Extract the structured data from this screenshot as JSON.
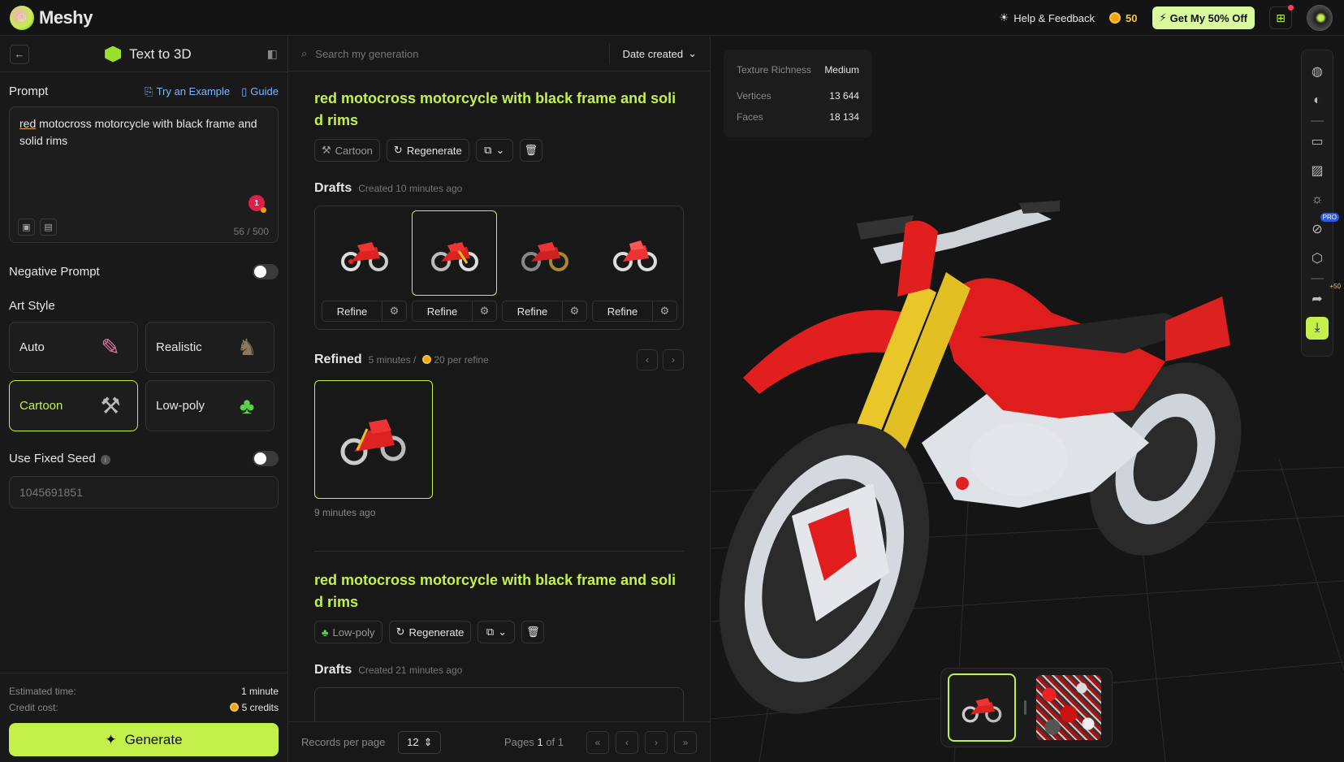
{
  "app": {
    "name": "Meshy"
  },
  "topbar": {
    "help_label": "Help & Feedback",
    "credits": "50",
    "deal_label": "Get My 50% Off"
  },
  "left": {
    "title": "Text to 3D",
    "prompt_label": "Prompt",
    "try_example": "Try an Example",
    "guide": "Guide",
    "prompt_first_word": "red",
    "prompt_rest": " motocross motorcycle with black frame and solid rims",
    "notification_count": "1",
    "char_counter": "56 / 500",
    "negative_prompt_label": "Negative Prompt",
    "negative_prompt_enabled": false,
    "art_style_label": "Art Style",
    "styles": [
      {
        "label": "Auto",
        "icon": "wand-icon",
        "selected": false
      },
      {
        "label": "Realistic",
        "icon": "creature-icon",
        "selected": false
      },
      {
        "label": "Cartoon",
        "icon": "hammer-icon",
        "selected": true
      },
      {
        "label": "Low-poly",
        "icon": "tree-icon",
        "selected": false
      }
    ],
    "fixed_seed_label": "Use Fixed Seed",
    "fixed_seed_enabled": false,
    "seed_placeholder": "1045691851",
    "estimated_time_label": "Estimated time:",
    "estimated_time": "1 minute",
    "credit_cost_label": "Credit cost:",
    "credit_cost": "5 credits",
    "generate_label": "Generate"
  },
  "middle": {
    "search_placeholder": "Search my generation",
    "sort_label": "Date created",
    "generations": [
      {
        "title": "red motocross motorcycle with black frame and solid rims",
        "style": "Cartoon",
        "regenerate": "Regenerate",
        "drafts_label": "Drafts",
        "drafts_meta": "Created 10 minutes ago",
        "drafts": [
          {
            "refine": "Refine",
            "selected": false
          },
          {
            "refine": "Refine",
            "selected": true
          },
          {
            "refine": "Refine",
            "selected": false
          },
          {
            "refine": "Refine",
            "selected": false
          }
        ],
        "refined_label": "Refined",
        "refined_meta_time": "5 minutes /",
        "refined_meta_cost": "20 per refine",
        "refined_ago": "9 minutes ago"
      },
      {
        "title": "red motocross motorcycle with black frame and solid rims",
        "style": "Low-poly",
        "regenerate": "Regenerate",
        "drafts_label": "Drafts",
        "drafts_meta": "Created 21 minutes ago"
      }
    ],
    "records_per_page_label": "Records per page",
    "records_per_page": "12",
    "pages_prefix": "Pages",
    "page_current": "1",
    "pages_suffix": "of 1"
  },
  "viewer": {
    "texture_richness_label": "Texture Richness",
    "texture_richness": "Medium",
    "vertices_label": "Vertices",
    "vertices": "13 644",
    "faces_label": "Faces",
    "faces": "18 134",
    "pro_badge": "PRO",
    "share_bonus": "+50"
  },
  "colors": {
    "accent": "#c3f04b",
    "link": "#7ab7ff",
    "coin": "#f2a40c"
  }
}
